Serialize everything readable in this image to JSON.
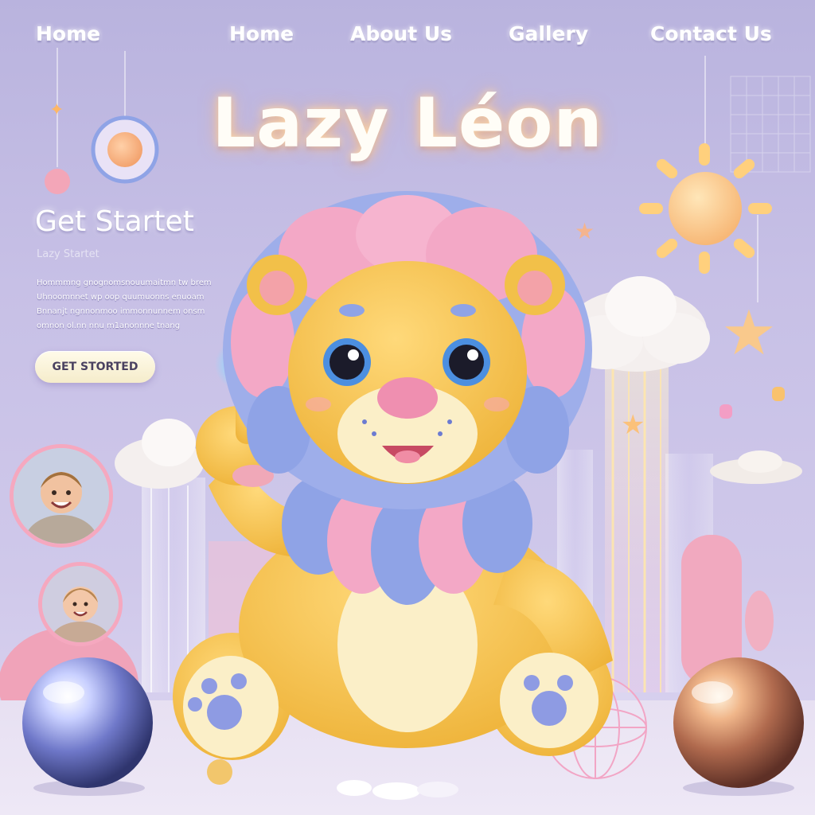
{
  "nav": {
    "items": [
      {
        "label": "Home"
      },
      {
        "label": "Home"
      },
      {
        "label": "About Us"
      },
      {
        "label": "Gallery"
      },
      {
        "label": "Contact Us"
      }
    ]
  },
  "hero": {
    "title": "Lazy Léon"
  },
  "intro": {
    "heading": "Get Startet",
    "faded_subtitle": "Lazy Startet",
    "paragraph_lines": [
      "Hommmng gnognomsnouumaitmn tw brem",
      "Uhnoomnnet wp oop quumuonns enuoam",
      "Bnnanjt ngnnonmoo immonnunnem onsm",
      "omnon ol.nn nnu m1anonnne tnang"
    ],
    "cta_label": "GET STORTED"
  },
  "avatars": [
    {
      "name": "child-avatar-1"
    },
    {
      "name": "child-avatar-2"
    }
  ],
  "colors": {
    "background": "#c7c0e6",
    "lion_body": "#f6c54a",
    "mane_pink": "#f3a8c6",
    "mane_blue": "#8fa3e6",
    "accent_sun": "#ffc98a",
    "cta_background": "#fffbea"
  },
  "icons": [
    "star-icon",
    "sun-icon",
    "cloud-icon",
    "orb-icon",
    "wire-globe-icon"
  ]
}
